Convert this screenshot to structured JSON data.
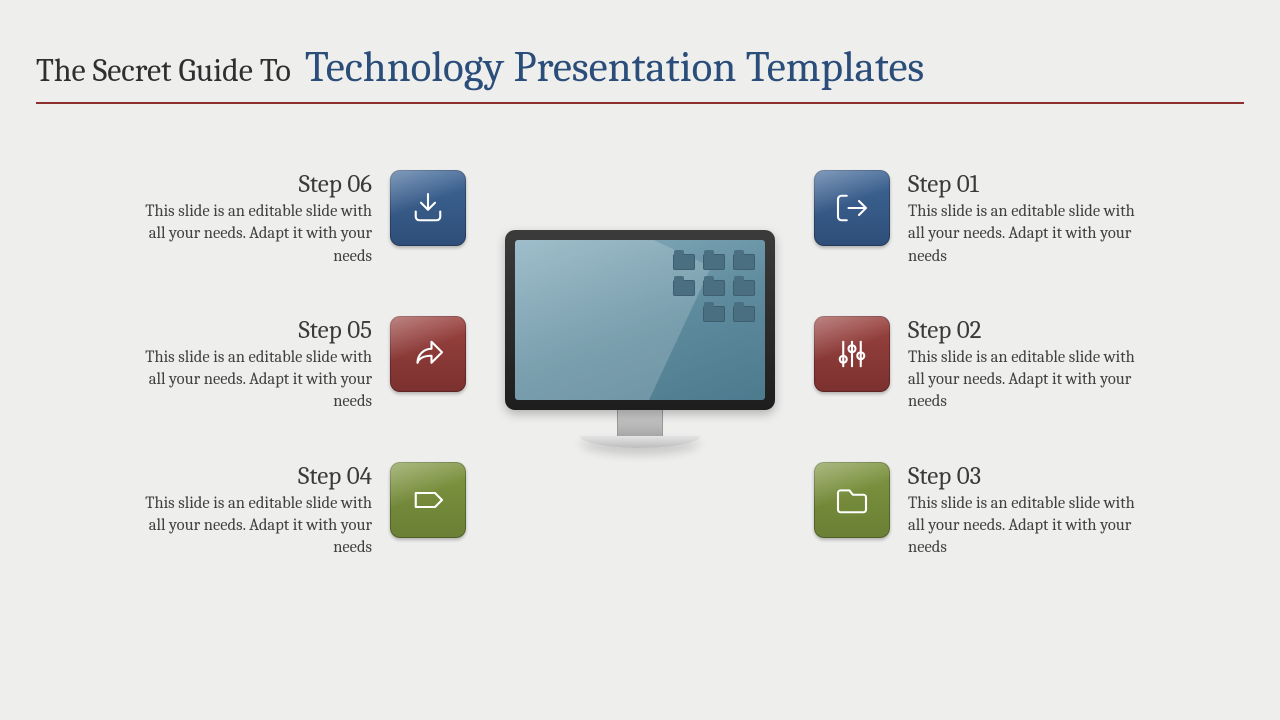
{
  "title": {
    "prefix": "The Secret Guide To",
    "main": "Technology Presentation Templates"
  },
  "colors": {
    "blue": "#345a86",
    "red": "#843734",
    "green": "#73893a",
    "rule": "#8b2f2f"
  },
  "left_items": [
    {
      "title": "Step 06",
      "desc": "This slide is an editable slide with all your needs. Adapt it with your needs",
      "icon": "download-tray-icon",
      "color": "blue"
    },
    {
      "title": "Step 05",
      "desc": "This slide is an editable slide with all your needs. Adapt it with your needs",
      "icon": "share-arrow-icon",
      "color": "red"
    },
    {
      "title": "Step 04",
      "desc": "This slide is an editable slide with all your needs. Adapt it with your needs",
      "icon": "tag-icon",
      "color": "green"
    }
  ],
  "right_items": [
    {
      "title": "Step 01",
      "desc": "This slide is an editable slide with all your needs. Adapt it with your needs",
      "icon": "exit-arrow-icon",
      "color": "blue"
    },
    {
      "title": "Step 02",
      "desc": "This slide is an editable slide with all your needs. Adapt it with your needs",
      "icon": "sliders-icon",
      "color": "red"
    },
    {
      "title": "Step 03",
      "desc": "This slide is an editable slide with all your needs. Adapt it with your needs",
      "icon": "folder-icon",
      "color": "green"
    }
  ]
}
